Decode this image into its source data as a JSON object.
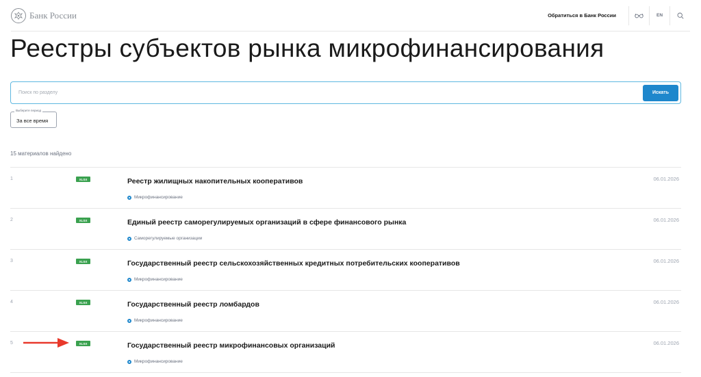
{
  "header": {
    "logo_text": "Банк России",
    "contact_link": "Обратиться в Банк России",
    "lang_link": "EN"
  },
  "page_title": "Реестры субъектов рынка микрофинансирования",
  "search": {
    "placeholder": "Поиск по разделу",
    "value": "",
    "button_label": "Искать"
  },
  "period": {
    "label": "Выберите период",
    "value": "За все время"
  },
  "results_count": "15 материалов найдено",
  "colors": {
    "accent": "#1e87cc",
    "search_border": "#5db7e0",
    "badge": "#3aa14f",
    "annotation": "#e8392b"
  },
  "results": [
    {
      "num": "1",
      "badge": "XLSX",
      "title": "Реестр жилищных накопительных кооперативов",
      "tag": "Микрофинансирование",
      "date": "06.01.2026"
    },
    {
      "num": "2",
      "badge": "XLSX",
      "title": "Единый реестр саморегулируемых организаций в сфере финансового рынка",
      "tag": "Саморегулируемые организации",
      "date": "06.01.2026"
    },
    {
      "num": "3",
      "badge": "XLSX",
      "title": "Государственный реестр сельскохозяйственных кредитных потребительских кооперативов",
      "tag": "Микрофинансирование",
      "date": "06.01.2026"
    },
    {
      "num": "4",
      "badge": "XLSX",
      "title": "Государственный реестр ломбардов",
      "tag": "Микрофинансирование",
      "date": "06.01.2026"
    },
    {
      "num": "5",
      "badge": "XLSX",
      "title": "Государственный реестр микрофинансовых организаций",
      "tag": "Микрофинансирование",
      "date": "06.01.2026"
    }
  ]
}
